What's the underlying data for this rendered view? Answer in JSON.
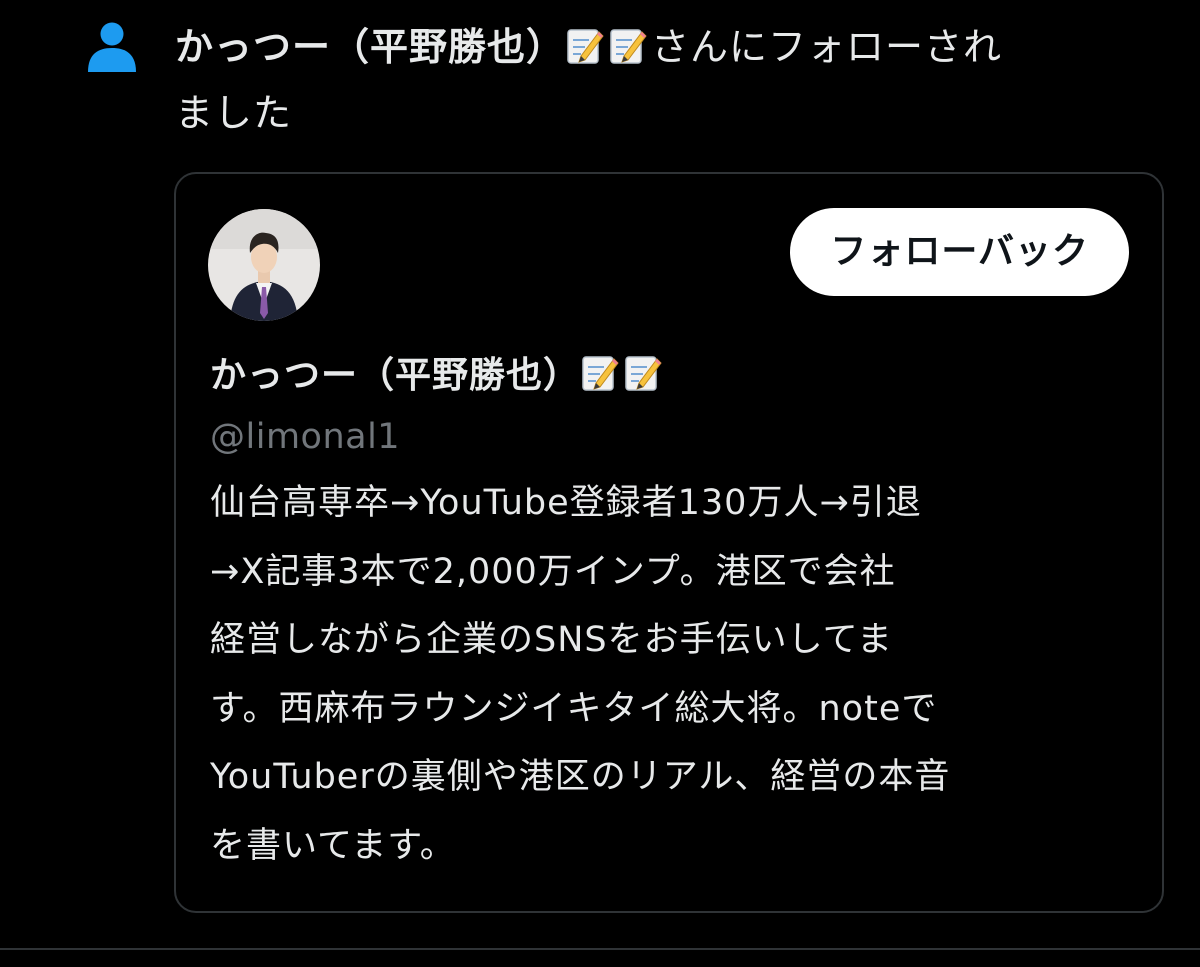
{
  "notification": {
    "icon": "person-icon",
    "actor_name": "かっつー（平野勝也）",
    "actor_emoji": [
      "memo-icon",
      "memo-icon"
    ],
    "action_line1": "さんにフォローされ",
    "action_line2": "ました"
  },
  "card": {
    "follow_back_label": "フォローバック",
    "display_name": "かっつー（平野勝也）",
    "name_emoji": [
      "memo-icon",
      "memo-icon"
    ],
    "handle": "@limonal1",
    "bio_lines": [
      "仙台高専卒→YouTube登録者130万人→引退",
      "→X記事3本で2,000万インプ。港区で会社",
      "経営しながら企業のSNSをお手伝いしてま",
      "す。西麻布ラウンジイキタイ総大将。noteで",
      "YouTuberの裏側や港区のリアル、経営の本音",
      "を書いてます。"
    ]
  },
  "colors": {
    "background": "#000000",
    "text_primary": "#e7e9ea",
    "text_secondary": "#71767b",
    "accent_blue": "#1d9bf0",
    "border": "#2f3336",
    "button_bg": "#ffffff",
    "button_text": "#0f1419"
  }
}
